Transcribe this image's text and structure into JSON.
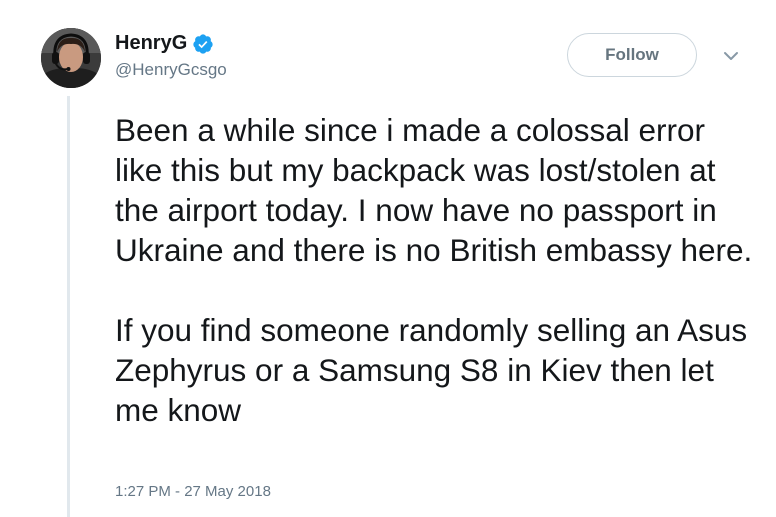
{
  "tweet": {
    "author": {
      "display_name": "HenryG",
      "handle": "@HenryGcsgo",
      "verified": true,
      "avatar_icon": "profile-photo"
    },
    "follow_label": "Follow",
    "menu_icon": "chevron-down-icon",
    "paragraphs": [
      "Been a while since i made a colossal error like this but my backpack was lost/stolen at the airport today. I now have no passport in Ukraine and there is no British embassy here.",
      "If you find someone randomly selling an Asus Zephyrus or a Samsung S8 in Kiev then let me know"
    ],
    "timestamp": "1:27 PM - 27 May 2018"
  },
  "colors": {
    "verified_blue": "#1da1f2",
    "text_primary": "#14171a",
    "text_secondary": "#657786",
    "border": "#ccd6dd",
    "thread_line": "#e1e8ed"
  }
}
